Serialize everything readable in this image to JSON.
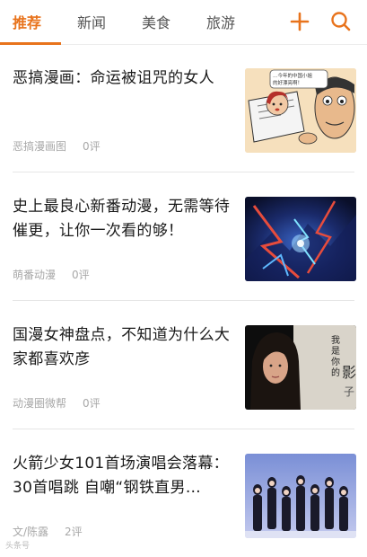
{
  "tabs": [
    {
      "label": "推荐",
      "active": true
    },
    {
      "label": "新闻",
      "active": false
    },
    {
      "label": "美食",
      "active": false
    },
    {
      "label": "旅游",
      "active": false
    }
  ],
  "icons": {
    "add": "plus-icon",
    "search": "search-icon"
  },
  "accent_color": "#e8731c",
  "articles": [
    {
      "title": "恶搞漫画：命运被诅咒的女人",
      "source": "恶搞漫画图",
      "comments": "0评",
      "thumb_text": "…今年的中国小姐的好漂亮啊！"
    },
    {
      "title": "史上最良心新番动漫，无需等待催更，让你一次看的够！",
      "source": "萌番动漫",
      "comments": "0评"
    },
    {
      "title": "国漫女神盘点，不知道为什么大家都喜欢彦",
      "source": "动漫圈微帮",
      "comments": "0评",
      "thumb_text_col1": "我是你的",
      "thumb_text_col2": "影子"
    },
    {
      "title": "火箭少女101首场演唱会落幕：30首唱跳 自嘲“钢铁直男…",
      "source": "文/陈露",
      "comments": "2评"
    }
  ],
  "watermark": "头条号"
}
